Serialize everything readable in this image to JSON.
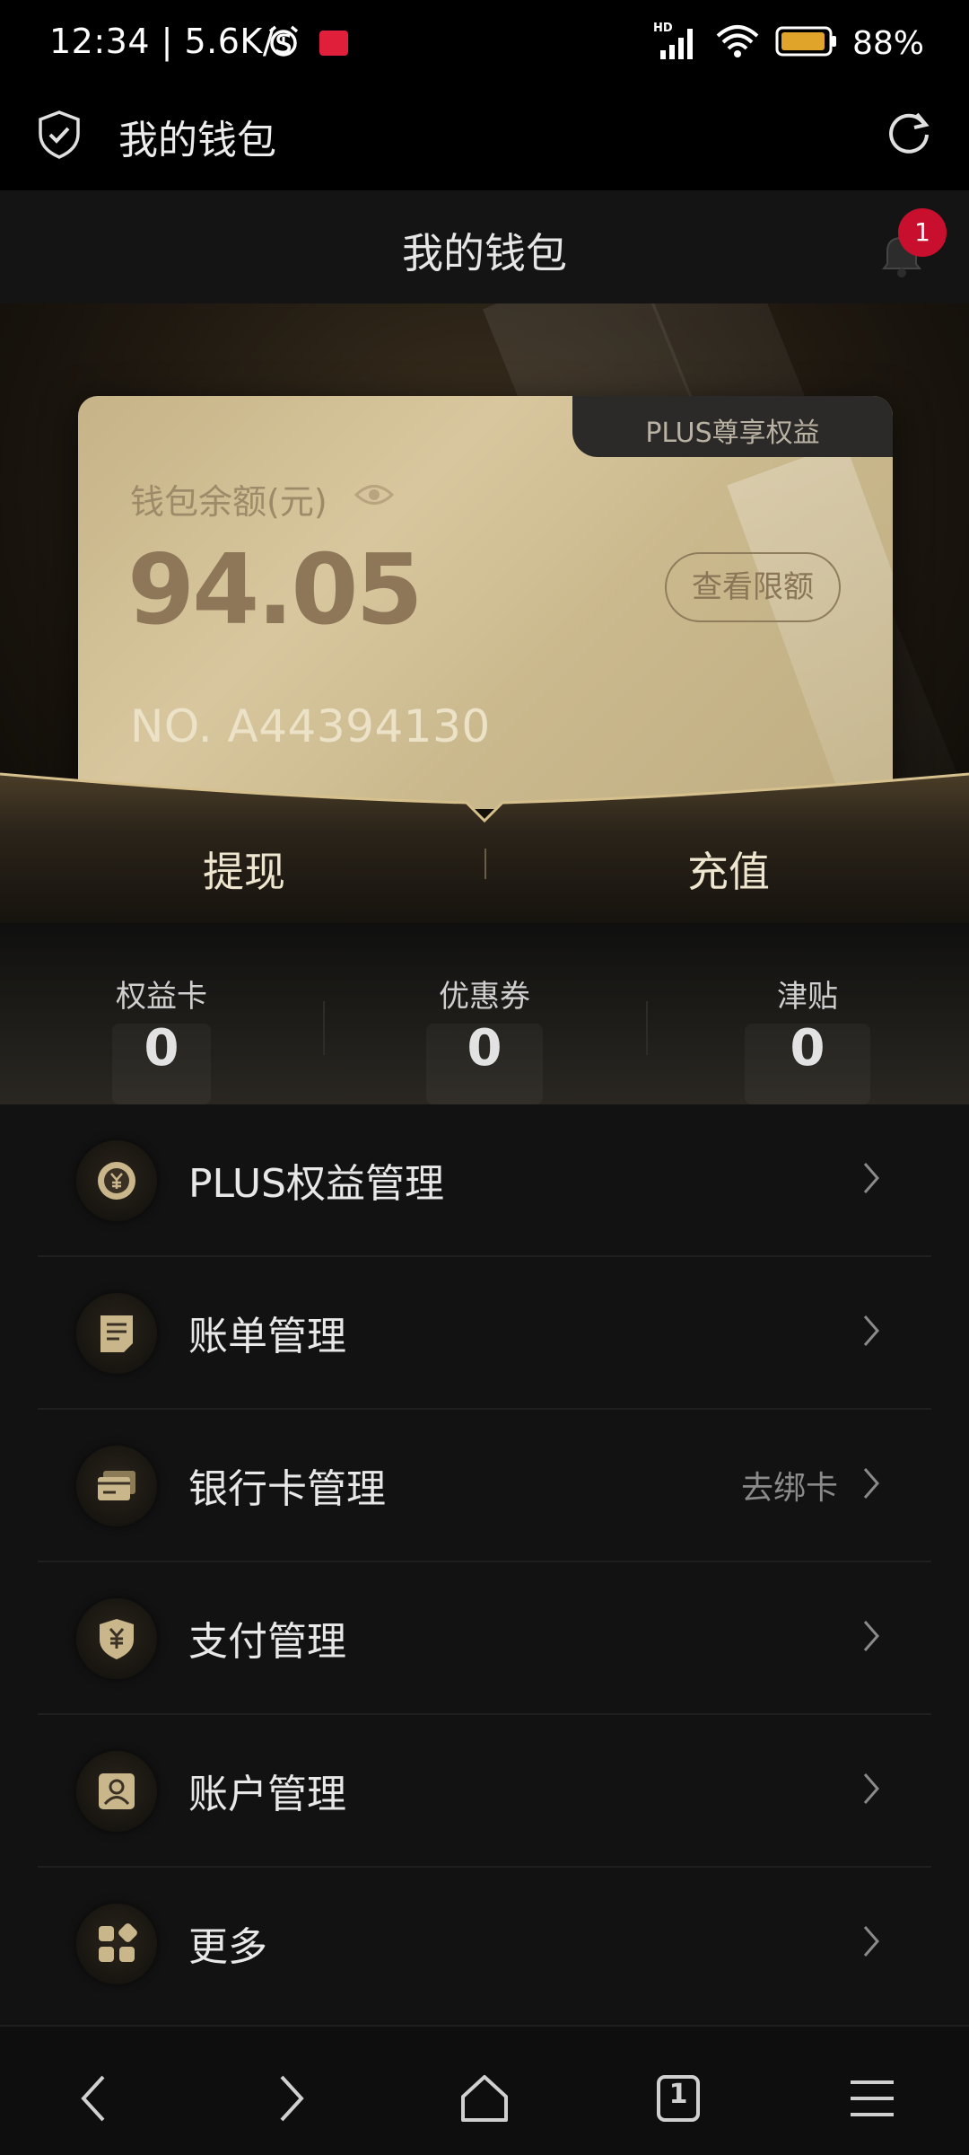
{
  "status_bar": {
    "time": "12:34 | 5.6K/s",
    "battery": "88%",
    "network_label": "HD"
  },
  "browser_header": {
    "title": "我的钱包"
  },
  "page": {
    "title": "我的钱包",
    "notification_count": "1"
  },
  "wallet_card": {
    "tab_label": "PLUS尊享权益",
    "balance_label": "钱包余额(元)",
    "balance": "94.05",
    "limit_button": "查看限额",
    "card_number": "NO. A44394130"
  },
  "actions": {
    "withdraw": "提现",
    "recharge": "充值"
  },
  "stats": [
    {
      "label": "权益卡",
      "value": "0"
    },
    {
      "label": "优惠券",
      "value": "0"
    },
    {
      "label": "津贴",
      "value": "0"
    }
  ],
  "menu": [
    {
      "label": "PLUS权益管理",
      "icon": "coin-icon",
      "extra": ""
    },
    {
      "label": "账单管理",
      "icon": "bill-icon",
      "extra": ""
    },
    {
      "label": "银行卡管理",
      "icon": "bank-card-icon",
      "extra": "去绑卡"
    },
    {
      "label": "支付管理",
      "icon": "shield-yuan-icon",
      "extra": ""
    },
    {
      "label": "账户管理",
      "icon": "user-icon",
      "extra": ""
    },
    {
      "label": "更多",
      "icon": "grid-icon",
      "extra": ""
    }
  ],
  "bottom_nav": {
    "tab_count": "1"
  },
  "colors": {
    "accent_gold": "#c9b68a",
    "badge_red": "#c8102e",
    "background": "#121212"
  }
}
